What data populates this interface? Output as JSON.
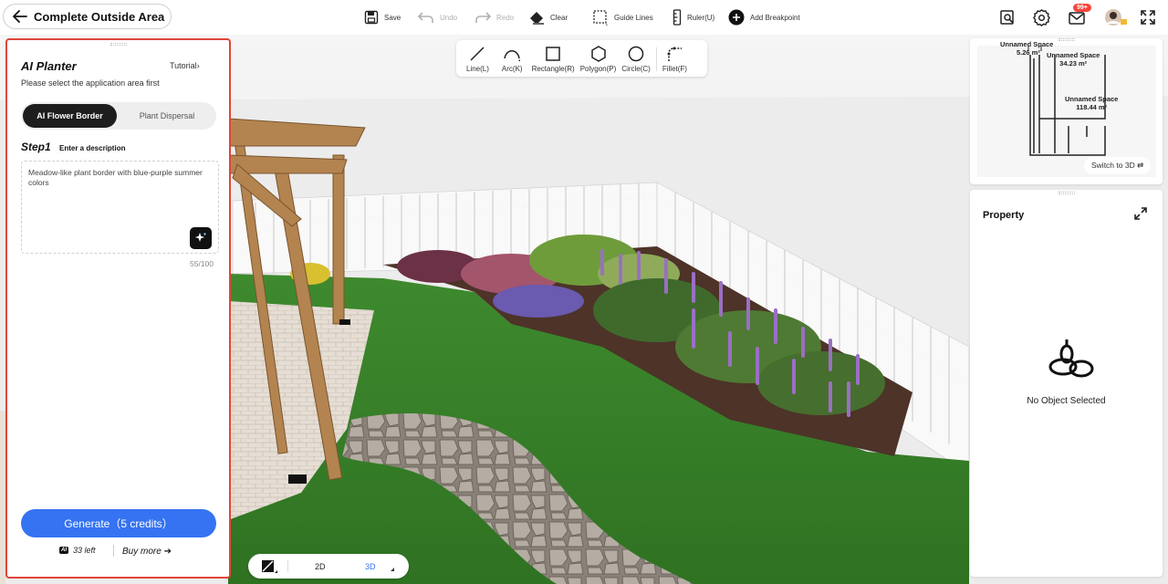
{
  "header": {
    "back_label": "Complete Outside Area",
    "tools": {
      "save": "Save",
      "undo": "Undo",
      "redo": "Redo",
      "clear": "Clear",
      "guide_lines": "Guide Lines",
      "ruler": "Ruler(U)",
      "add_breakpoint": "Add Breakpoint"
    },
    "notification_badge": "99+"
  },
  "draw_tools": [
    {
      "label": "Line(L)",
      "icon": "line-icon"
    },
    {
      "label": "Arc(K)",
      "icon": "arc-icon"
    },
    {
      "label": "Rectangle(R)",
      "icon": "rectangle-icon"
    },
    {
      "label": "Polygon(P)",
      "icon": "polygon-icon"
    },
    {
      "label": "Circle(C)",
      "icon": "circle-icon"
    },
    {
      "label": "Fillet(F)",
      "icon": "fillet-icon"
    }
  ],
  "ai_planter": {
    "title": "AI Planter",
    "tutorial": "Tutorial",
    "subtitle": "Please select the application area first",
    "modes": {
      "active": "AI Flower Border",
      "inactive": "Plant Dispersal"
    },
    "step_label": "Step1",
    "step_desc": "Enter a description",
    "description": "Meadow-like plant border with blue-purple summer colors",
    "counter": "55/100",
    "generate": "Generate（5 credits）",
    "credits_left": "33 left",
    "credits_logo": "AI",
    "buy_more": "Buy more"
  },
  "minimap": {
    "spaces": [
      {
        "name": "Unnamed Space",
        "area": "5.26 m²"
      },
      {
        "name": "Unnamed Space",
        "area": "34.23 m²"
      },
      {
        "name": "Unnamed Space",
        "area": "118.44 m²"
      }
    ],
    "switch_label": "Switch to 3D"
  },
  "property": {
    "title": "Property",
    "empty_text": "No Object Selected"
  },
  "view_toggle": {
    "option_2d": "2D",
    "option_3d": "3D",
    "active": "3D"
  },
  "colors": {
    "accent": "#3573f2",
    "highlight_border": "#e0453a",
    "badge": "#f5443b"
  }
}
